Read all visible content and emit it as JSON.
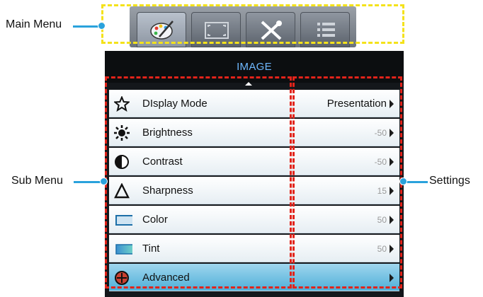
{
  "main_menu": {
    "tabs": [
      {
        "name": "image-tab",
        "icon": "palette-icon",
        "active": true
      },
      {
        "name": "display-tab",
        "icon": "screen-icon",
        "active": false
      },
      {
        "name": "setup-tab",
        "icon": "tools-icon",
        "active": false
      },
      {
        "name": "info-tab",
        "icon": "list-icon",
        "active": false
      }
    ]
  },
  "panel": {
    "title": "IMAGE",
    "items": [
      {
        "label": "DIsplay Mode",
        "value": "Presentation",
        "icon": "star-icon"
      },
      {
        "label": "Brightness",
        "value": "-50",
        "icon": "brightness-icon"
      },
      {
        "label": "Contrast",
        "value": "-50",
        "icon": "contrast-icon"
      },
      {
        "label": "Sharpness",
        "value": "15",
        "icon": "sharpness-icon"
      },
      {
        "label": "Color",
        "value": "50",
        "icon": "color-icon"
      },
      {
        "label": "Tint",
        "value": "50",
        "icon": "tint-icon"
      },
      {
        "label": "Advanced",
        "value": "",
        "icon": "advanced-icon",
        "selected": true
      }
    ]
  },
  "annotations": {
    "main_menu": "Main Menu",
    "sub_menu": "Sub Menu",
    "settings": "Settings"
  },
  "colors": {
    "main_menu_box": "#f4e21b",
    "sub_menu_box": "#e2231a",
    "callout_line": "#2aa2dc",
    "title_text": "#6fb8ff",
    "selected_row": "#4fb0d8"
  }
}
